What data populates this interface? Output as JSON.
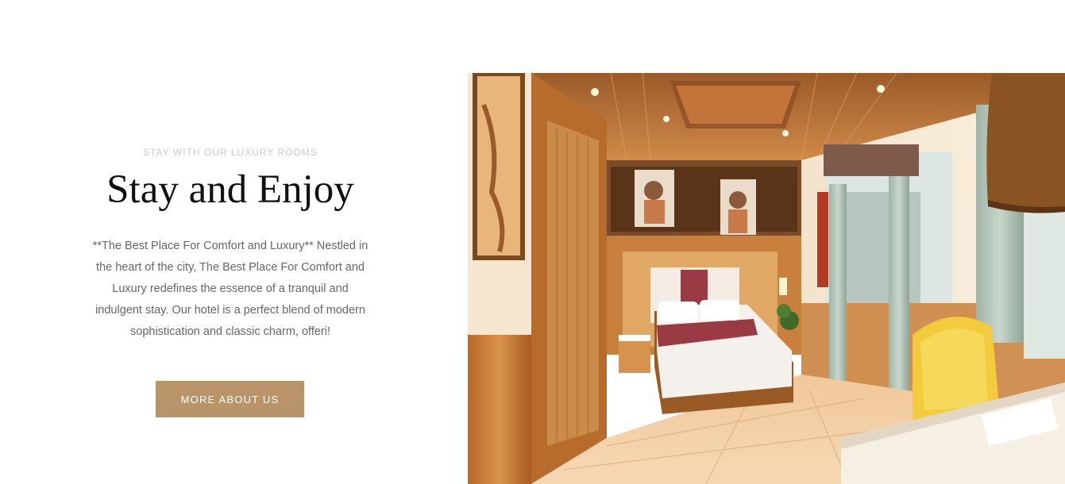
{
  "intro": {
    "eyebrow": "STAY WITH OUR LUXURY ROOMS",
    "title": "Stay and Enjoy",
    "description": "**The Best Place For Comfort and Luxury** Nestled in the heart of the city, The Best Place For Comfort and Luxury redefines the essence of a tranquil and indulgent stay. Our hotel is a perfect blend of modern sophistication and classic charm, offeri!",
    "button_label": "MORE ABOUT US"
  },
  "colors": {
    "accent": "#b89468",
    "eyebrow": "#c9c9c9",
    "title": "#111111",
    "body_text": "#666666"
  }
}
